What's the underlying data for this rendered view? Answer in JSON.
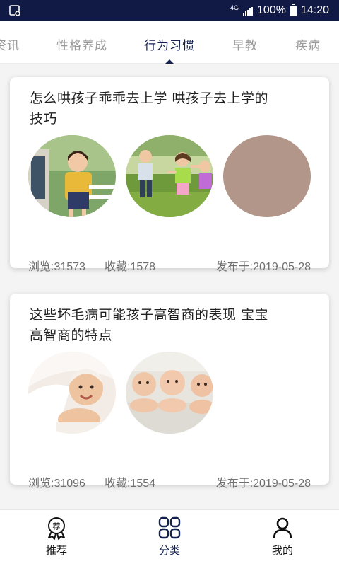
{
  "status_bar": {
    "network": "4G",
    "battery": "100%",
    "time": "14:20",
    "icons": [
      "gallery-icon",
      "signal-icon",
      "battery-icon"
    ]
  },
  "tabs": [
    {
      "label": "资讯",
      "active": false
    },
    {
      "label": "性格养成",
      "active": false
    },
    {
      "label": "行为习惯",
      "active": true
    },
    {
      "label": "早教",
      "active": false
    },
    {
      "label": "疾病",
      "active": false
    }
  ],
  "articles": [
    {
      "title": "怎么哄孩子乖乖去上学 哄孩子去上学的技巧",
      "views": "浏览:31573",
      "favorites": "收藏:1578",
      "published": "发布于:2019-05-28",
      "images": [
        "girl-with-backpack-photo",
        "children-running-photo",
        "loading-placeholder"
      ]
    },
    {
      "title": "这些坏毛病可能孩子高智商的表现 宝宝高智商的特点",
      "views": "浏览:31096",
      "favorites": "收藏:1554",
      "published": "发布于:2019-05-28",
      "images": [
        "baby-under-blanket-photo",
        "three-babies-photo"
      ]
    }
  ],
  "bottom_nav": [
    {
      "label": "推荐",
      "icon": "recommend-badge-icon",
      "active": false
    },
    {
      "label": "分类",
      "icon": "grid-categories-icon",
      "active": true
    },
    {
      "label": "我的",
      "icon": "user-profile-icon",
      "active": false
    }
  ],
  "colors": {
    "status_bar": "#101a44",
    "accent": "#14204e",
    "inactive_tab": "#9a9a9a",
    "placeholder_thumb": "#b3968a"
  }
}
